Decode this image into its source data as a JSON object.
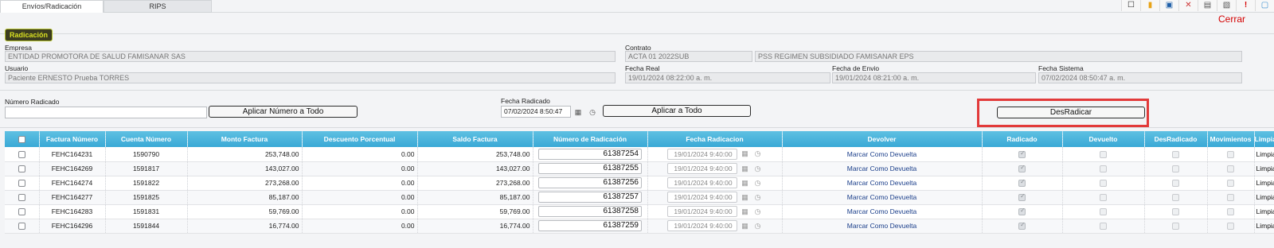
{
  "tabs": [
    {
      "label": "Envíos/Radicación"
    },
    {
      "label": "RIPS"
    }
  ],
  "toolbar": {
    "icons": [
      "new-icon",
      "open-icon",
      "save-icon",
      "delete-icon",
      "print-icon",
      "export-icon",
      "alert-icon",
      "chat-icon"
    ],
    "cerrar": "Cerrar"
  },
  "section": {
    "title": "Radicación"
  },
  "form": {
    "empresa_label": "Empresa",
    "empresa": "ENTIDAD PROMOTORA DE SALUD FAMISANAR SAS",
    "contrato_label": "Contrato",
    "contrato_code": "ACTA 01 2022SUB",
    "contrato_name": "PSS REGIMEN SUBSIDIADO FAMISANAR EPS",
    "usuario_label": "Usuario",
    "usuario": "Paciente ERNESTO Prueba TORRES",
    "fecha_real_label": "Fecha Real",
    "fecha_real": "19/01/2024 08:22:00 a. m.",
    "fecha_envio_label": "Fecha de Envio",
    "fecha_envio": "19/01/2024 08:21:00 a. m.",
    "fecha_sistema_label": "Fecha Sistema",
    "fecha_sistema": "07/02/2024 08:50:47 a. m."
  },
  "radicado": {
    "numero_label": "Número Radicado",
    "numero_value": "",
    "aplicar_numero": "Aplicar Número a Todo",
    "fecha_label": "Fecha Radicado",
    "fecha_value": "07/02/2024 8:50:47",
    "aplicar_todo": "Aplicar a Todo",
    "desradicar": "DesRadicar"
  },
  "table": {
    "headers": [
      "Factura Número",
      "Cuenta Número",
      "Monto Factura",
      "Descuento Porcentual",
      "Saldo Factura",
      "Número de Radicación",
      "Fecha Radicacion",
      "Devolver",
      "Radicado",
      "Devuelto",
      "DesRadicado",
      "Movimientos",
      "Limpiar"
    ],
    "rows": [
      {
        "factura": "FEHC164231",
        "cuenta": "1590790",
        "monto": "253,748.00",
        "descuento": "0.00",
        "saldo": "253,748.00",
        "radicacion": "61387254",
        "fecha": "19/01/2024 9:40:00",
        "devolver": "Marcar Como Devuelta",
        "limpiar": "Limpiar"
      },
      {
        "factura": "FEHC164269",
        "cuenta": "1591817",
        "monto": "143,027.00",
        "descuento": "0.00",
        "saldo": "143,027.00",
        "radicacion": "61387255",
        "fecha": "19/01/2024 9:40:00",
        "devolver": "Marcar Como Devuelta",
        "limpiar": "Limpiar"
      },
      {
        "factura": "FEHC164274",
        "cuenta": "1591822",
        "monto": "273,268.00",
        "descuento": "0.00",
        "saldo": "273,268.00",
        "radicacion": "61387256",
        "fecha": "19/01/2024 9:40:00",
        "devolver": "Marcar Como Devuelta",
        "limpiar": "Limpiar"
      },
      {
        "factura": "FEHC164277",
        "cuenta": "1591825",
        "monto": "85,187.00",
        "descuento": "0.00",
        "saldo": "85,187.00",
        "radicacion": "61387257",
        "fecha": "19/01/2024 9:40:00",
        "devolver": "Marcar Como Devuelta",
        "limpiar": "Limpiar"
      },
      {
        "factura": "FEHC164283",
        "cuenta": "1591831",
        "monto": "59,769.00",
        "descuento": "0.00",
        "saldo": "59,769.00",
        "radicacion": "61387258",
        "fecha": "19/01/2024 9:40:00",
        "devolver": "Marcar Como Devuelta",
        "limpiar": "Limpiar"
      },
      {
        "factura": "FEHC164296",
        "cuenta": "1591844",
        "monto": "16,774.00",
        "descuento": "0.00",
        "saldo": "16,774.00",
        "radicacion": "61387259",
        "fecha": "19/01/2024 9:40:00",
        "devolver": "Marcar Como Devuelta",
        "limpiar": "Limpiar"
      }
    ]
  },
  "colors": {
    "header": "#3aa9d6",
    "highlight": "#e23a3a",
    "cerrar": "#d40000",
    "section_badge": "#d9e021"
  }
}
